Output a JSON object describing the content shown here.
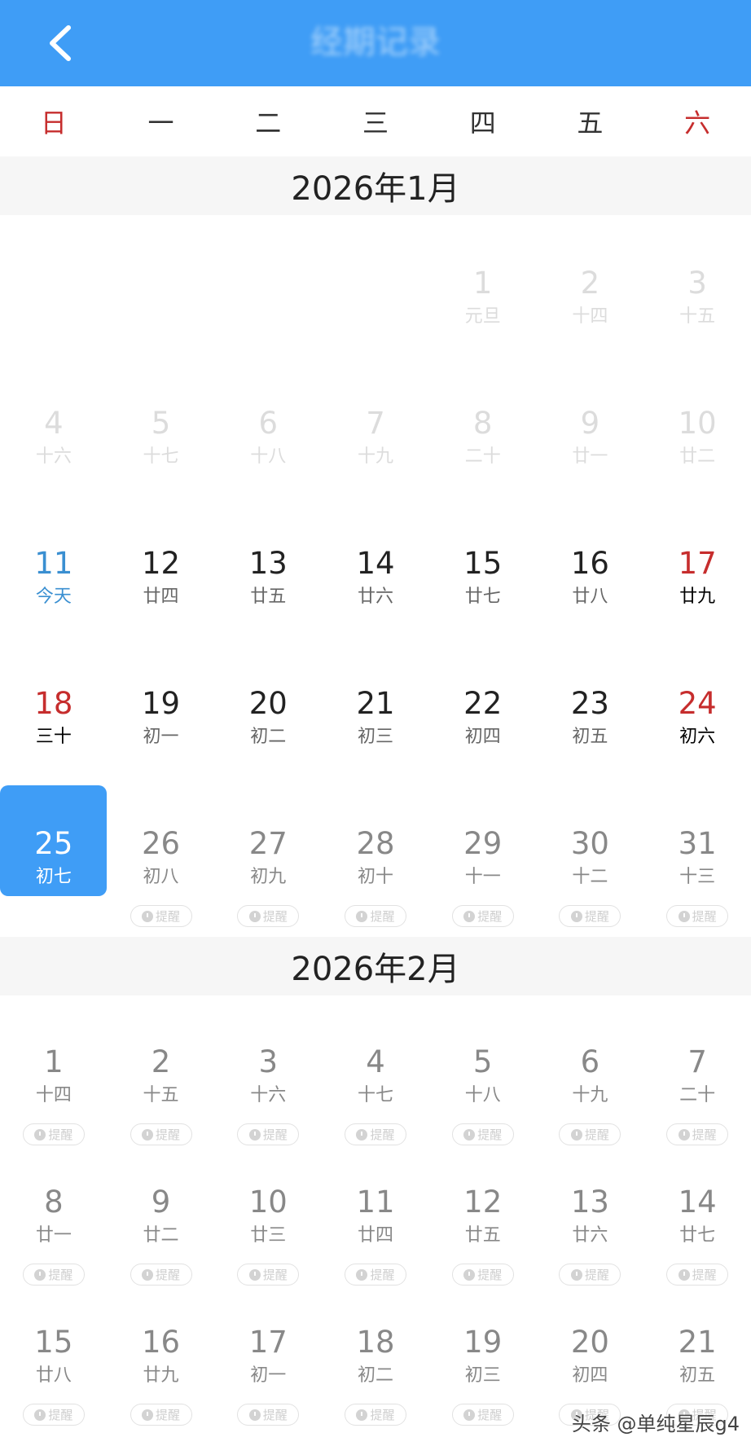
{
  "header": {
    "title": "经期记录"
  },
  "weekdays": [
    "日",
    "一",
    "二",
    "三",
    "四",
    "五",
    "六"
  ],
  "months": [
    {
      "title": "2026年1月",
      "remind_label": "提醒",
      "weeks": [
        [
          null,
          null,
          null,
          null,
          {
            "d": "1",
            "l": "元旦",
            "s": "past"
          },
          {
            "d": "2",
            "l": "十四",
            "s": "past"
          },
          {
            "d": "3",
            "l": "十五",
            "s": "past"
          }
        ],
        [
          {
            "d": "4",
            "l": "十六",
            "s": "past"
          },
          {
            "d": "5",
            "l": "十七",
            "s": "past"
          },
          {
            "d": "6",
            "l": "十八",
            "s": "past"
          },
          {
            "d": "7",
            "l": "十九",
            "s": "past"
          },
          {
            "d": "8",
            "l": "二十",
            "s": "past"
          },
          {
            "d": "9",
            "l": "廿一",
            "s": "past"
          },
          {
            "d": "10",
            "l": "廿二",
            "s": "past"
          }
        ],
        [
          {
            "d": "11",
            "l": "今天",
            "s": "today"
          },
          {
            "d": "12",
            "l": "廿四",
            "s": "cur"
          },
          {
            "d": "13",
            "l": "廿五",
            "s": "cur"
          },
          {
            "d": "14",
            "l": "廿六",
            "s": "cur"
          },
          {
            "d": "15",
            "l": "廿七",
            "s": "cur"
          },
          {
            "d": "16",
            "l": "廿八",
            "s": "cur"
          },
          {
            "d": "17",
            "l": "廿九",
            "s": "red"
          }
        ],
        [
          {
            "d": "18",
            "l": "三十",
            "s": "red"
          },
          {
            "d": "19",
            "l": "初一",
            "s": "cur"
          },
          {
            "d": "20",
            "l": "初二",
            "s": "cur"
          },
          {
            "d": "21",
            "l": "初三",
            "s": "cur"
          },
          {
            "d": "22",
            "l": "初四",
            "s": "cur"
          },
          {
            "d": "23",
            "l": "初五",
            "s": "cur"
          },
          {
            "d": "24",
            "l": "初六",
            "s": "red"
          }
        ],
        [
          {
            "d": "25",
            "l": "初七",
            "s": "selected"
          },
          {
            "d": "26",
            "l": "初八",
            "s": "future",
            "r": true
          },
          {
            "d": "27",
            "l": "初九",
            "s": "future",
            "r": true
          },
          {
            "d": "28",
            "l": "初十",
            "s": "future",
            "r": true
          },
          {
            "d": "29",
            "l": "十一",
            "s": "future",
            "r": true
          },
          {
            "d": "30",
            "l": "十二",
            "s": "future",
            "r": true
          },
          {
            "d": "31",
            "l": "十三",
            "s": "future",
            "r": true
          }
        ]
      ]
    },
    {
      "title": "2026年2月",
      "remind_label": "提醒",
      "weeks": [
        [
          {
            "d": "1",
            "l": "十四",
            "s": "future",
            "r": true
          },
          {
            "d": "2",
            "l": "十五",
            "s": "future",
            "r": true
          },
          {
            "d": "3",
            "l": "十六",
            "s": "future",
            "r": true
          },
          {
            "d": "4",
            "l": "十七",
            "s": "future",
            "r": true
          },
          {
            "d": "5",
            "l": "十八",
            "s": "future",
            "r": true
          },
          {
            "d": "6",
            "l": "十九",
            "s": "future",
            "r": true
          },
          {
            "d": "7",
            "l": "二十",
            "s": "future",
            "r": true
          }
        ],
        [
          {
            "d": "8",
            "l": "廿一",
            "s": "future",
            "r": true
          },
          {
            "d": "9",
            "l": "廿二",
            "s": "future",
            "r": true
          },
          {
            "d": "10",
            "l": "廿三",
            "s": "future",
            "r": true
          },
          {
            "d": "11",
            "l": "廿四",
            "s": "future",
            "r": true
          },
          {
            "d": "12",
            "l": "廿五",
            "s": "future",
            "r": true
          },
          {
            "d": "13",
            "l": "廿六",
            "s": "future",
            "r": true
          },
          {
            "d": "14",
            "l": "廿七",
            "s": "future",
            "r": true
          }
        ],
        [
          {
            "d": "15",
            "l": "廿八",
            "s": "future",
            "r": true
          },
          {
            "d": "16",
            "l": "廿九",
            "s": "future",
            "r": true
          },
          {
            "d": "17",
            "l": "初一",
            "s": "future",
            "r": true
          },
          {
            "d": "18",
            "l": "初二",
            "s": "future",
            "r": true
          },
          {
            "d": "19",
            "l": "初三",
            "s": "future",
            "r": true
          },
          {
            "d": "20",
            "l": "初四",
            "s": "future",
            "r": true
          },
          {
            "d": "21",
            "l": "初五",
            "s": "future",
            "r": true
          }
        ]
      ]
    }
  ],
  "watermark": "头条 @单纯星辰g4",
  "colors": {
    "accent": "#3f9df6",
    "holiday_red": "#c62d2d",
    "today_blue": "#3a8fd1"
  }
}
